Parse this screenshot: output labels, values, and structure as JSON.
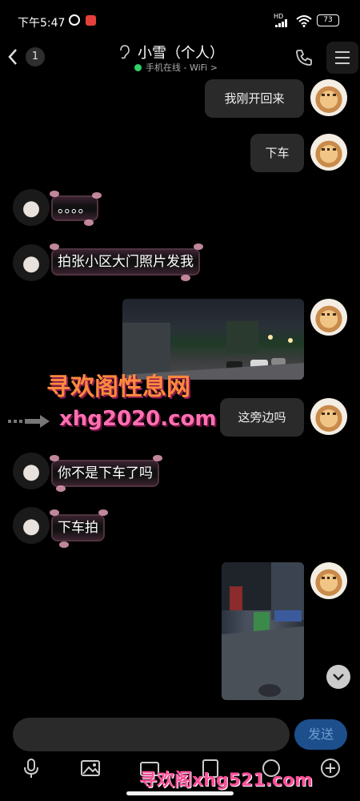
{
  "status_bar": {
    "time": "下午5:47",
    "network": "HD",
    "battery": "73"
  },
  "header": {
    "unread_count": "1",
    "contact_name": "小雪（个人）",
    "online_status": "手机在线 - WiFi >"
  },
  "messages": [
    {
      "side": "right",
      "type": "text",
      "text": "我刚开回来"
    },
    {
      "side": "right",
      "type": "text",
      "text": "下车"
    },
    {
      "side": "left",
      "type": "text",
      "text": "。。。。"
    },
    {
      "side": "left",
      "type": "text",
      "text": "拍张小区大门照片发我"
    },
    {
      "side": "right",
      "type": "image",
      "caption": "night photo of community gate"
    },
    {
      "side": "right",
      "type": "text",
      "text": "这旁边吗"
    },
    {
      "side": "left",
      "type": "text",
      "text": "你不是下车了吗"
    },
    {
      "side": "left",
      "type": "text",
      "text": "下车拍"
    },
    {
      "side": "right",
      "type": "image",
      "caption": "night street photo"
    }
  ],
  "watermark": {
    "title": "寻欢阁性息网",
    "url": "xhg2020.com",
    "footer": "寻欢阁xhg521.com"
  },
  "input": {
    "send_label": "发送"
  },
  "colors": {
    "background": "#000000",
    "bubble_right": "#2a2a2a",
    "send_button": "#1c4f8c",
    "online_green": "#2fd16a"
  }
}
